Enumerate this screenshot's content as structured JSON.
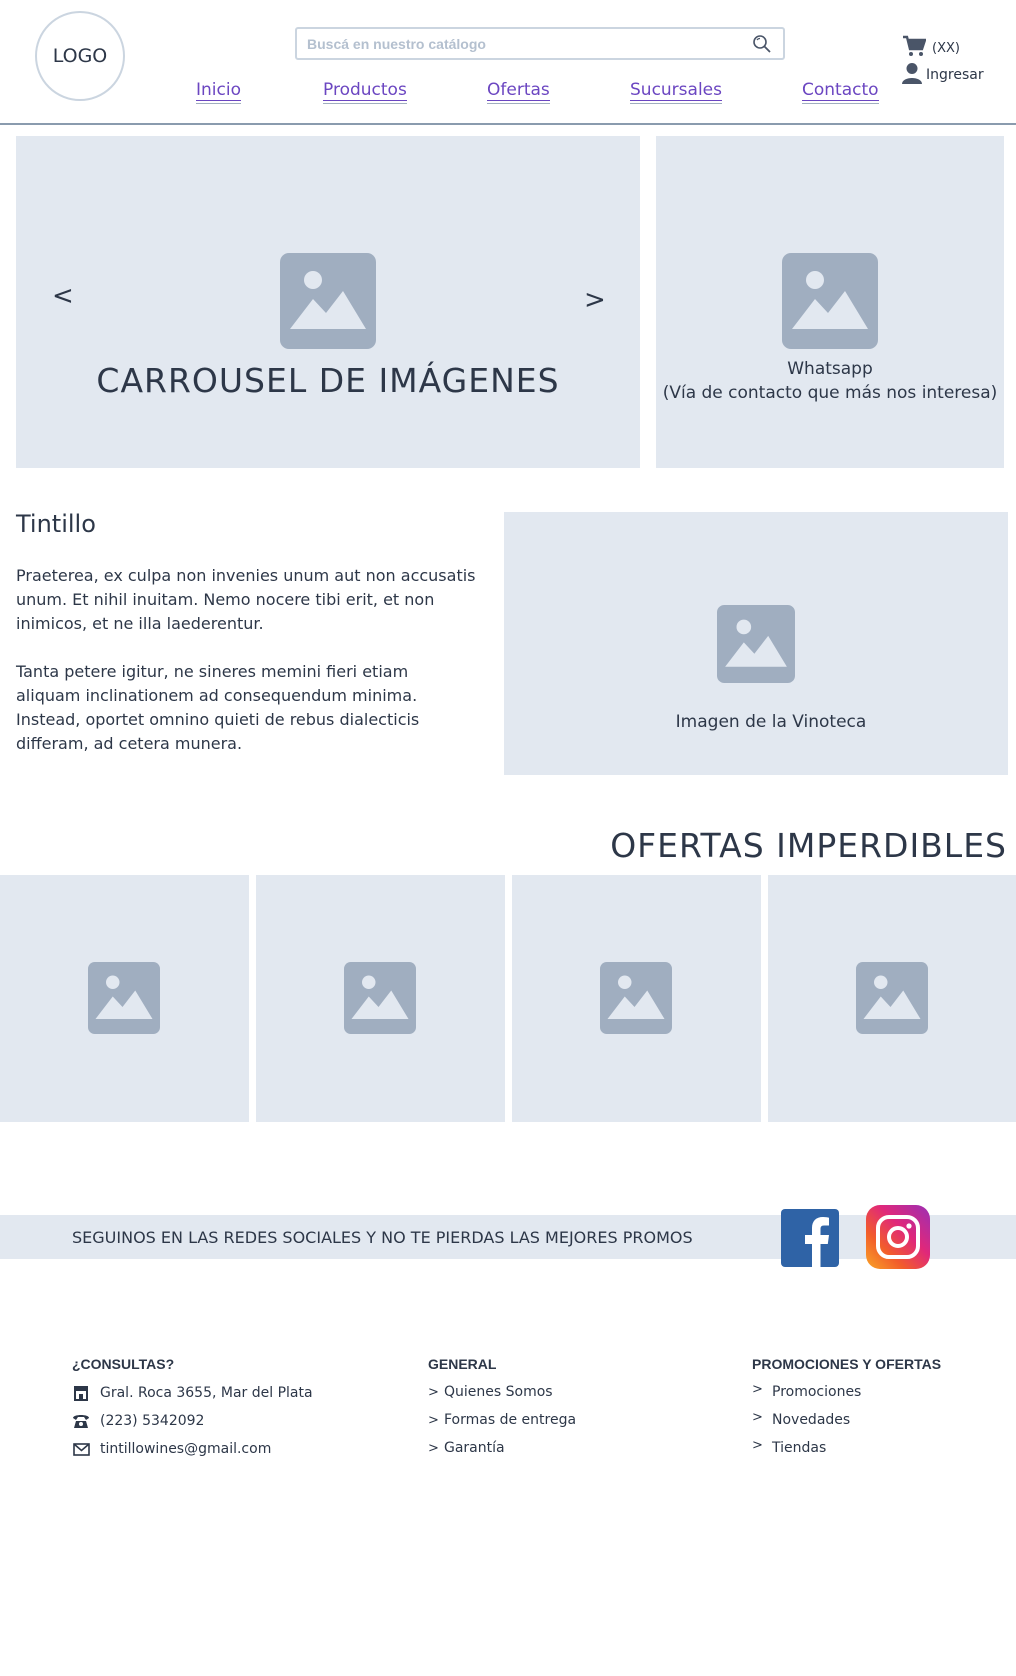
{
  "header": {
    "logo": "LOGO",
    "search_placeholder": "Buscá en nuestro catálogo",
    "nav": [
      "Inicio",
      "Productos",
      "Ofertas",
      "Sucursales",
      "Contacto"
    ],
    "cart_count": "(XX)",
    "login": "Ingresar"
  },
  "hero": {
    "carousel_title": "CARROUSEL DE IMÁGENES",
    "prev": "<",
    "next": ">",
    "whatsapp_title": "Whatsapp",
    "whatsapp_subtitle": "(Vía de contacto que más nos interesa)"
  },
  "about": {
    "title": "Tintillo",
    "p1": "Praeterea, ex culpa non invenies unum aut non accusatis unum. Et nihil inuitam. Nemo nocere tibi erit, et non inimicos, et ne illa laederentur.",
    "p2": "Tanta petere igitur, ne sineres memini fieri etiam aliquam inclinationem ad consequendum minima. Instead, oportet omnino quieti de rebus dialecticis differam, ad cetera munera.",
    "image_caption": "Imagen de la Vinoteca"
  },
  "offers": {
    "title": "OFERTAS IMPERDIBLES"
  },
  "social": {
    "text": "SEGUINOS EN LAS REDES SOCIALES Y NO TE PIERDAS LAS MEJORES PROMOS"
  },
  "footer": {
    "contact_title": "¿CONSULTAS?",
    "address": "Gral. Roca 3655, Mar del Plata",
    "phone": "(223) 5342092",
    "email": "tintillowines@gmail.com",
    "general_title": "GENERAL",
    "general_items": [
      "Quienes Somos",
      "Formas de entrega",
      "Garantía"
    ],
    "promo_title": "PROMOCIONES Y OFERTAS",
    "promo_items": [
      "Promociones",
      "Novedades",
      "Tiendas"
    ],
    "chevron": ">"
  },
  "colors": {
    "placeholder_bg": "#e2e8f0",
    "placeholder_icon": "#a0aec0",
    "link": "#6b46c1",
    "text": "#2d3748"
  }
}
